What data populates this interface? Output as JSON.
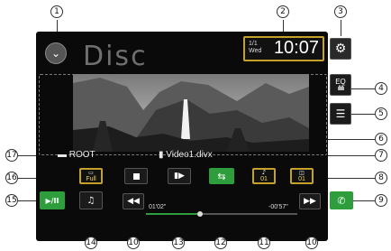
{
  "screen": {
    "background_word": "Disc",
    "path_folder": "ROOT",
    "path_file": "Video1.divx",
    "accent_gold": "#c4a22a",
    "accent_green": "#2e9e3c"
  },
  "clock": {
    "date_top": "1/1",
    "date_bottom": "Wed",
    "time": "10:07"
  },
  "buttons": {
    "source_menu_icon": "chevron-down-icon",
    "settings_icon": "gear-icon",
    "eq_label": "EQ",
    "list_icon": "list-icon",
    "subtitle_label": "Full",
    "audio_label": "01",
    "angle_label": "01",
    "play_pause_label": "▶/II",
    "stop_icon": "stop-icon",
    "slow_icon": "slow-play-icon",
    "repeat_icon": "repeat-icon",
    "prev_icon": "previous-track-icon",
    "next_icon": "next-track-icon",
    "media_icon": "media-panel-icon",
    "phone_icon": "phone-icon"
  },
  "playback": {
    "elapsed": "01'02\"",
    "remaining": "-00'57\"",
    "progress": 0.36
  },
  "callouts": [
    "1",
    "2",
    "3",
    "4",
    "5",
    "6",
    "7",
    "8",
    "9",
    "10",
    "11",
    "12",
    "13",
    "14",
    "15",
    "16",
    "17",
    "10"
  ]
}
